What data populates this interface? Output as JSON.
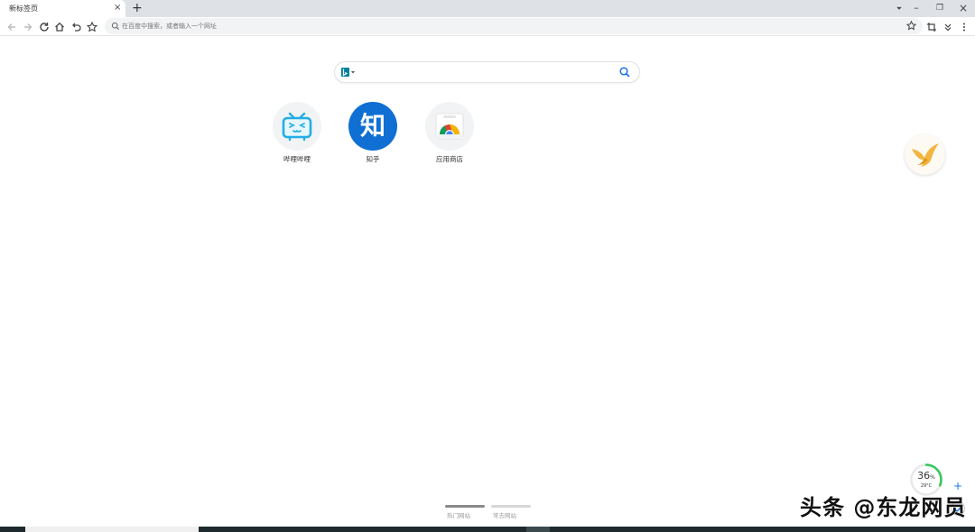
{
  "tab": {
    "title": "新标签页",
    "close": "×",
    "new_tab": "+"
  },
  "window_controls": {
    "dropdown": "⏷",
    "minimize": "–",
    "restore": "❐",
    "close": "×"
  },
  "toolbar": {
    "back_icon": "arrow-left-icon",
    "forward_icon": "arrow-right-icon",
    "reload_icon": "reload-icon",
    "home_icon": "home-icon",
    "undo_icon": "undo-icon",
    "bookmark_icon": "star-icon"
  },
  "omnibox": {
    "placeholder": "在百度中搜索，或者输入一个网址"
  },
  "search": {
    "engine_icon": "bing-icon",
    "search_icon": "search-icon"
  },
  "shortcuts": [
    {
      "label": "哔哩哔哩",
      "icon": "bilibili-icon"
    },
    {
      "label": "知乎",
      "icon": "zhihu-icon",
      "glyph": "知"
    },
    {
      "label": "应用商店",
      "icon": "chrome-icon"
    }
  ],
  "bottom_tabs": [
    {
      "label": "热门网站",
      "active": true
    },
    {
      "label": "常去网站",
      "active": false
    }
  ],
  "weather": {
    "percent": "36",
    "percent_unit": "%",
    "temp": "29°C"
  },
  "watermark": "头条 @东龙网员",
  "colors": {
    "accent": "#1a73e8",
    "zhihu": "#0f6fd3",
    "bilibili": "#23ade5",
    "taskbar": "#1e2a2d"
  }
}
